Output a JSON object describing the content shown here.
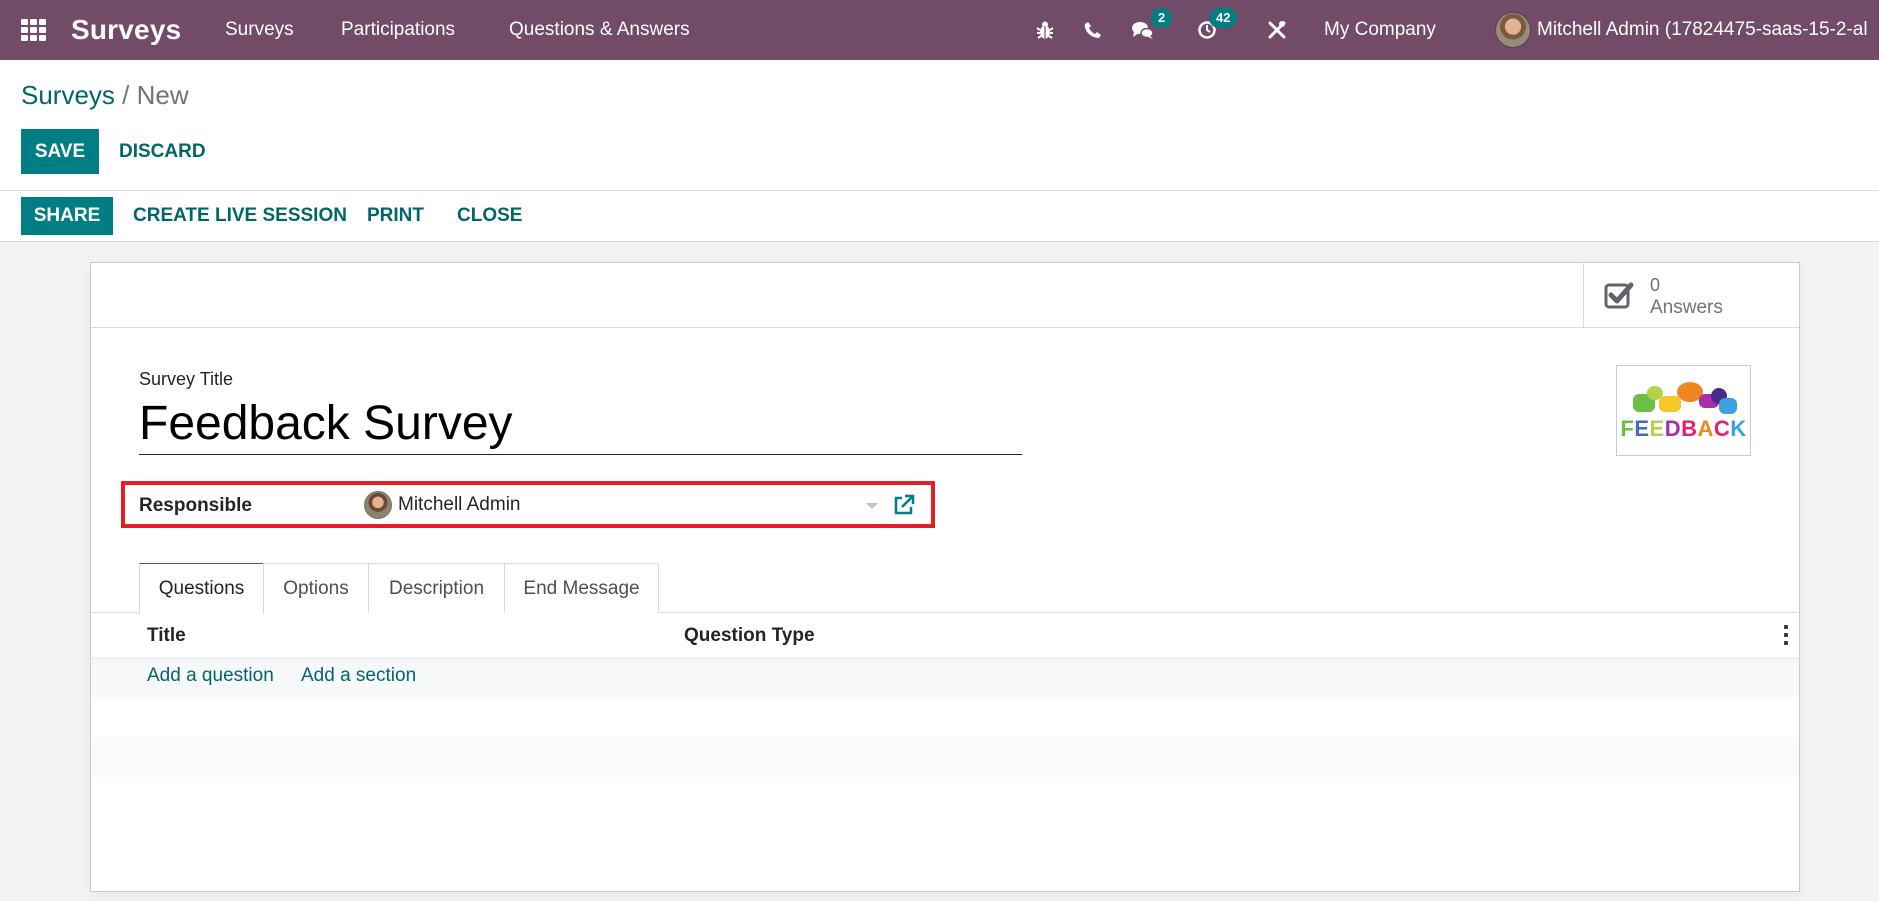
{
  "navbar": {
    "brand": "Surveys",
    "menu": [
      "Surveys",
      "Participations",
      "Questions & Answers"
    ],
    "icons": {
      "apps": "apps-grid-icon",
      "debug": "bug-icon",
      "phone": "phone-icon",
      "messages": "chat-icon",
      "activities": "clock-icon",
      "tools": "tools-icon"
    },
    "messages_badge": "2",
    "activities_badge": "42",
    "company": "My Company",
    "user": "Mitchell Admin (17824475-saas-15-2-al"
  },
  "control": {
    "breadcrumb": {
      "parent": "Surveys",
      "separator": "/",
      "current": "New"
    },
    "save_label": "SAVE",
    "discard_label": "DISCARD",
    "status_buttons": {
      "share": "SHARE",
      "live_session": "CREATE LIVE SESSION",
      "print": "PRINT",
      "close": "CLOSE"
    }
  },
  "sheet": {
    "stat": {
      "value": "0",
      "label": "Answers",
      "icon": "check-square-icon"
    },
    "title_label": "Survey Title",
    "title_value": "Feedback Survey",
    "image_text": "FEEDBACK",
    "responsible_label": "Responsible",
    "responsible_value": "Mitchell Admin",
    "tabs": [
      "Questions",
      "Options",
      "Description",
      "End Message"
    ],
    "active_tab": "Questions",
    "columns": [
      "Title",
      "Question Type"
    ],
    "add_question": "Add a question",
    "add_section": "Add a section"
  },
  "colors": {
    "navbar": "#714b67",
    "primary": "#017e84",
    "link": "#01666b",
    "highlight": "#e31e24"
  }
}
